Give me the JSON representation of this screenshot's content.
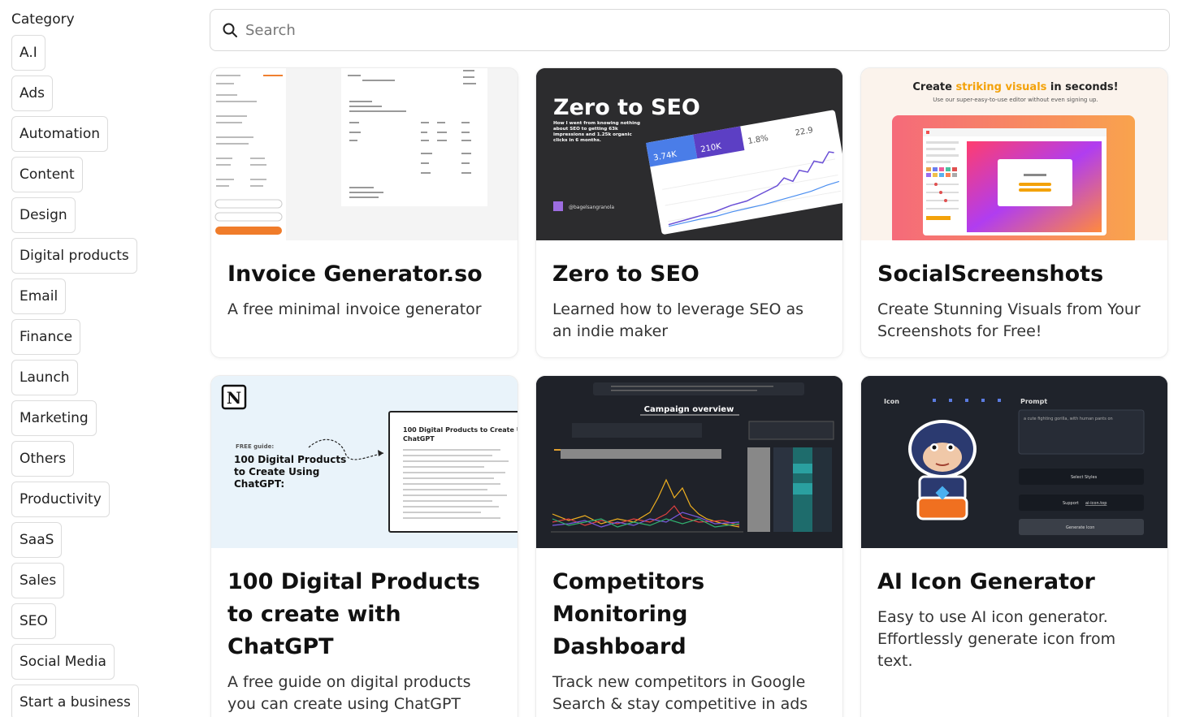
{
  "sidebar": {
    "title": "Category",
    "categories": [
      "A.I",
      "Ads",
      "Automation",
      "Content",
      "Design",
      "Digital products",
      "Email",
      "Finance",
      "Launch",
      "Marketing",
      "Others",
      "Productivity",
      "SaaS",
      "Sales",
      "SEO",
      "Social Media",
      "Start a business"
    ]
  },
  "search": {
    "placeholder": "Search",
    "value": ""
  },
  "cards": [
    {
      "title": "Invoice Generator.so",
      "description": "A free minimal invoice generator"
    },
    {
      "title": "Zero to SEO",
      "description": "Learned how to leverage SEO as an indie maker",
      "thumb": {
        "headline": "Zero to SEO",
        "tagline_1": "How I went from knowing nothing",
        "tagline_2": "about SEO to getting 63k",
        "tagline_3": "impressions and 1.25k organic",
        "tagline_4": "clicks in 6 months.",
        "handle": "@bagelsangranola",
        "stat_1": "3.74K",
        "stat_2": "210K",
        "stat_3": "1.8%",
        "stat_4": "22.9"
      }
    },
    {
      "title": "SocialScreenshots",
      "description": "Create Stunning Visuals from Your Screenshots for Free!",
      "thumb": {
        "headline_a": "Create ",
        "headline_b": "striking visuals",
        "headline_c": " in seconds!",
        "subline": "Use our super-easy-to-use editor without even signing up."
      }
    },
    {
      "title": "100 Digital Products to create with ChatGPT",
      "description": "A free guide on digital products you can create using ChatGPT",
      "thumb": {
        "free": "FREE guide:",
        "guide_title_1": "100 Digital Products",
        "guide_title_2": "to Create Using",
        "guide_title_3": "ChatGPT:",
        "doc_title_1": "100 Digital Products to Create Usin",
        "doc_title_2": "ChatGPT"
      }
    },
    {
      "title": "Competitors Monitoring Dashboard",
      "description": "Track new competitors in Google Search & stay competitive in ads auction",
      "thumb": {
        "label": "Campaign overview"
      }
    },
    {
      "title": "AI Icon Generator",
      "description": "Easy to use AI icon generator. Effortlessly generate icon from text.",
      "thumb": {
        "icon_label": "Icon",
        "prompt_label": "Prompt",
        "prompt_text": "a cute fighting gorilla, with human pants on",
        "select_styles": "Select Styles",
        "support": "Support",
        "support_link": "ai-icon.top",
        "generate": "Generate Icon"
      }
    }
  ]
}
